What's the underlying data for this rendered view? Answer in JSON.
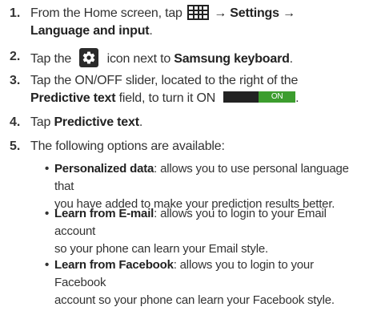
{
  "steps": [
    {
      "num": "1.",
      "pre": "From the Home screen, tap ",
      "icon": "apps-grid-icon",
      "post_bold_1": " → Settings →",
      "line2_bold": "Language and input",
      "line2_tail": "."
    },
    {
      "num": "2.",
      "pre": "Tap the ",
      "icon": "gear-icon",
      "mid": " icon next to ",
      "bold": "Samsung keyboard",
      "tail": "."
    },
    {
      "num": "3.",
      "line1": "Tap the ON/OFF slider, located to the right of the",
      "line2_bold": "Predictive text",
      "line2_mid": " field, to turn it ON",
      "toggle_label": "ON",
      "line2_tail": "."
    },
    {
      "num": "4.",
      "pre": "Tap ",
      "bold": "Predictive text",
      "tail": "."
    },
    {
      "num": "5.",
      "text": "The following options are available:"
    }
  ],
  "options": [
    {
      "title": "Personalized data",
      "desc_1": ": allows you to use personal language that",
      "desc_2": "you have added to make your prediction results better."
    },
    {
      "title": "Learn from E-mail",
      "desc_1": ": allows you to login to your Email account",
      "desc_2": "so your phone can learn your Email style."
    },
    {
      "title": "Learn from Facebook",
      "desc_1": ": allows you to login to your Facebook",
      "desc_2": "account so your phone can learn your Facebook style."
    }
  ],
  "colors": {
    "text": "#333333",
    "toggle_on": "#3c9d2e",
    "toggle_off": "#222222"
  }
}
